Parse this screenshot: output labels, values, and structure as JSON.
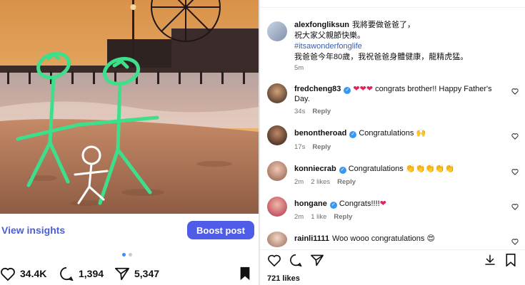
{
  "left": {
    "insights_label": "View insights",
    "boost_label": "Boost post",
    "likes_count": "34.4K",
    "comments_count": "1,394",
    "shares_count": "5,347",
    "carousel": {
      "total": 2,
      "active_index": 0
    }
  },
  "post": {
    "author": "alexfongliksun",
    "caption_lines": [
      "我將要做爸爸了，",
      "祝大家父親節快樂。"
    ],
    "hashtag": "#itsawonderfonglife",
    "caption_extra": "我爸爸今年80歲，我祝爸爸身體健康，龍精虎猛。",
    "time": "5m"
  },
  "comments": [
    {
      "user": "fredcheng83",
      "text": "congrats brother!! Happy Father's Day.",
      "emoji": "❤❤❤",
      "time": "34s",
      "likes": "",
      "reply": "Reply"
    },
    {
      "user": "benontheroad",
      "text": "Congratulations",
      "emoji": "🙌",
      "time": "17s",
      "likes": "",
      "reply": "Reply"
    },
    {
      "user": "konniecrab",
      "text": "Congratulations",
      "emoji": "👏👏👏👏👏",
      "time": "2m",
      "likes": "2 likes",
      "reply": "Reply"
    },
    {
      "user": "hongane",
      "text": "Congrats!!!!",
      "emoji": "❤",
      "time": "2m",
      "likes": "1 like",
      "reply": "Reply"
    },
    {
      "user": "rainli1111",
      "text": "Woo wooo congratulations",
      "emoji": "😍",
      "time": "",
      "likes": "",
      "reply": ""
    }
  ],
  "post_likes": "721 likes",
  "colors": {
    "accent": "#4f5ce8",
    "link": "#4a5ed8",
    "verified": "#3897f0",
    "heart": "#e0245e"
  }
}
